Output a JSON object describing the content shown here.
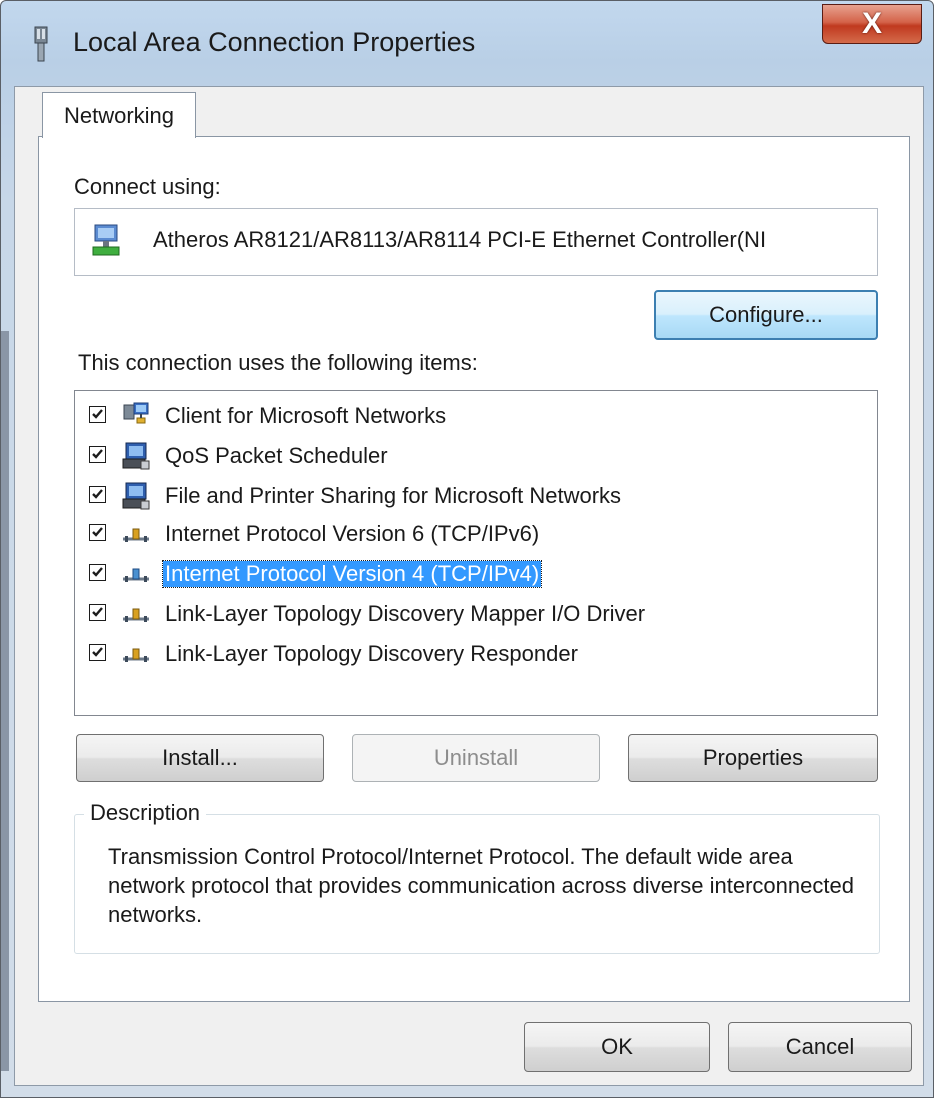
{
  "window": {
    "title": "Local Area Connection Properties",
    "close_glyph": "X"
  },
  "tabs": [
    {
      "label": "Networking"
    }
  ],
  "connect_using_label": "Connect using:",
  "adapter": {
    "name": "Atheros AR8121/AR8113/AR8114 PCI-E Ethernet Controller(NI",
    "icon": "network-adapter-icon"
  },
  "configure_button": "Configure...",
  "items_label": "This connection uses the following items:",
  "items": [
    {
      "label": "Client for Microsoft Networks",
      "checked": true,
      "icon": "network-client-icon"
    },
    {
      "label": "QoS Packet Scheduler",
      "checked": true,
      "icon": "service-icon"
    },
    {
      "label": "File and Printer Sharing for Microsoft Networks",
      "checked": true,
      "icon": "service-icon"
    },
    {
      "label": "Internet Protocol Version 6 (TCP/IPv6)",
      "checked": true,
      "icon": "protocol-icon"
    },
    {
      "label": "Internet Protocol Version 4 (TCP/IPv4)",
      "checked": true,
      "icon": "protocol-icon",
      "selected": true
    },
    {
      "label": "Link-Layer Topology Discovery Mapper I/O Driver",
      "checked": true,
      "icon": "protocol-icon"
    },
    {
      "label": "Link-Layer Topology Discovery Responder",
      "checked": true,
      "icon": "protocol-icon"
    }
  ],
  "buttons": {
    "install": "Install...",
    "uninstall": "Uninstall",
    "properties": "Properties",
    "ok": "OK",
    "cancel": "Cancel"
  },
  "description": {
    "title": "Description",
    "text": "Transmission Control Protocol/Internet Protocol. The default wide area network protocol that provides communication across diverse interconnected networks."
  },
  "colors": {
    "selection": "#3399ff",
    "close_button": "#c7432a",
    "focus_border": "#3c7fb1"
  }
}
